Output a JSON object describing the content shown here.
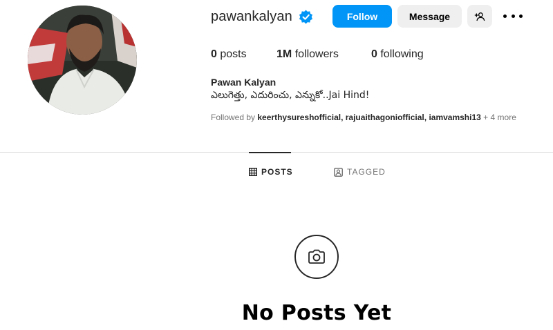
{
  "profile": {
    "username": "pawankalyan",
    "verified": true,
    "full_name": "Pawan Kalyan",
    "bio": "ఎలుగెత్తు, ఎదురించు, ఎన్నుకో..Jai Hind!"
  },
  "actions": {
    "follow_label": "Follow",
    "message_label": "Message",
    "add_user_icon": "person-add-icon",
    "more_icon": "more-horizontal-icon"
  },
  "stats": {
    "posts_count": "0",
    "posts_label": "posts",
    "followers_count": "1M",
    "followers_label": "followers",
    "following_count": "0",
    "following_label": "following"
  },
  "followed_by": {
    "prefix": "Followed by",
    "names": "keerthysureshofficial, rajuaithagoniofficial, iamvamshi13",
    "more": "+ 4 more"
  },
  "tabs": [
    {
      "label": "POSTS",
      "icon": "grid-icon",
      "active": true
    },
    {
      "label": "TAGGED",
      "icon": "tagged-icon",
      "active": false
    }
  ],
  "empty_state": {
    "icon": "camera-icon",
    "title": "No Posts Yet"
  },
  "colors": {
    "primary_button": "#0095f6",
    "secondary_button": "#efefef",
    "verified_badge": "#0095f6",
    "divider": "#dbdbdb",
    "muted_text": "#737373"
  }
}
